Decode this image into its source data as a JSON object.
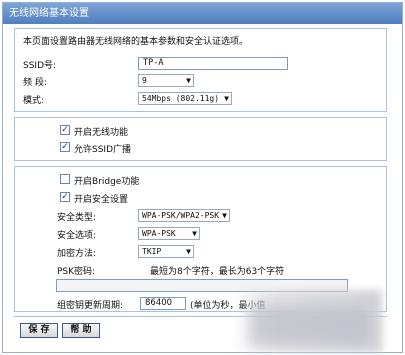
{
  "window": {
    "title": "无线网络基本设置"
  },
  "intro": "本页面设置路由器无线网络的基本参数和安全认证选项。",
  "basic": {
    "ssid_label": "SSID号:",
    "ssid_value": "TP-A",
    "channel_label": "频 段:",
    "channel_value": "9",
    "mode_label": "模式:",
    "mode_value": "54Mbps (802.11g)"
  },
  "toggles": {
    "enable_wireless": {
      "label": "开启无线功能",
      "checked": true
    },
    "enable_ssid_broadcast": {
      "label": "允许SSID广播",
      "checked": true
    }
  },
  "security": {
    "enable_bridge": {
      "label": "开启Bridge功能",
      "checked": false
    },
    "enable_security": {
      "label": "开启安全设置",
      "checked": true
    },
    "type_label": "安全类型:",
    "type_value": "WPA-PSK/WPA2-PSK",
    "option_label": "安全选项:",
    "option_value": "WPA-PSK",
    "encryption_label": "加密方法:",
    "encryption_value": "TKIP",
    "psk_label": "PSK密码:",
    "psk_hint": "最短为8个字符，最长为63个字符",
    "psk_value": "",
    "renew_label": "组密钥更新周期:",
    "renew_value": "86400",
    "renew_hint": "(单位为秒，最小值"
  },
  "buttons": {
    "save": "保 存",
    "help": "帮 助"
  },
  "icons": {
    "dropdown": "▼",
    "check": "✓"
  }
}
